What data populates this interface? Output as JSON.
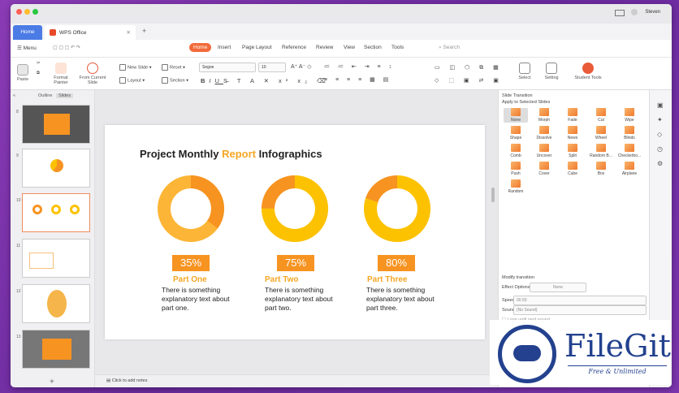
{
  "window": {
    "home_tab": "Home",
    "doc_tab": "WPS Office",
    "user": "Steven",
    "search_placeholder": "Search"
  },
  "menu": {
    "menu_label": "Menu",
    "tabs": [
      "Home",
      "Insert",
      "Page Layout",
      "Reference",
      "Review",
      "View",
      "Section",
      "Tools"
    ]
  },
  "toolbar": {
    "paste": "Paste",
    "format_painter": "Format Painter",
    "from_current": "From Current Slide",
    "new_slide": "New Slide",
    "reset": "Reset",
    "layout": "Layout",
    "section": "Section",
    "font": "Segoe",
    "size": "10",
    "select": "Select",
    "setting": "Setting",
    "student_tools": "Student Tools"
  },
  "left_panel": {
    "tab_outline": "Outline",
    "tab_slides": "Slides",
    "slides": [
      "8",
      "9",
      "10",
      "11",
      "12",
      "13"
    ],
    "add": "+"
  },
  "slide": {
    "title_pre": "Project Monthly ",
    "title_hl": "Report",
    "title_post": " Infographics",
    "parts": [
      {
        "pct": "35%",
        "name": "Part One",
        "desc": "There is something explanatory text about part one.",
        "value": 35,
        "color": "#f79321"
      },
      {
        "pct": "75%",
        "name": "Part Two",
        "desc": "There is something explanatory text about part two.",
        "value": 75,
        "color": "#fcc200"
      },
      {
        "pct": "80%",
        "name": "Part Three",
        "desc": "There is something explanatory text about part three.",
        "value": 80,
        "color": "#fcc200"
      }
    ]
  },
  "notes": "Click to add notes",
  "transition": {
    "header": "Slide Transition",
    "apply": "Apply to Selected Slides",
    "items": [
      "None",
      "Morph",
      "Fade",
      "Cut",
      "Wipe",
      "Shape",
      "Dissolve",
      "News",
      "Wheel",
      "Blinds",
      "Comb",
      "Uncover",
      "Split",
      "Random B...",
      "Checkerbo...",
      "Push",
      "Cover",
      "Cube",
      "Box",
      "Airplane",
      "Random"
    ],
    "modify": "Modify transition",
    "effect_label": "Effect Options:",
    "effect_value": "None",
    "speed_label": "Speed:",
    "speed_value": "00.50",
    "sound_label": "Sound:",
    "sound_value": "(No Sound)",
    "loop": "Loop until next sound"
  },
  "watermark": {
    "name": "FileGit",
    "tagline": "Free & Unlimited"
  }
}
